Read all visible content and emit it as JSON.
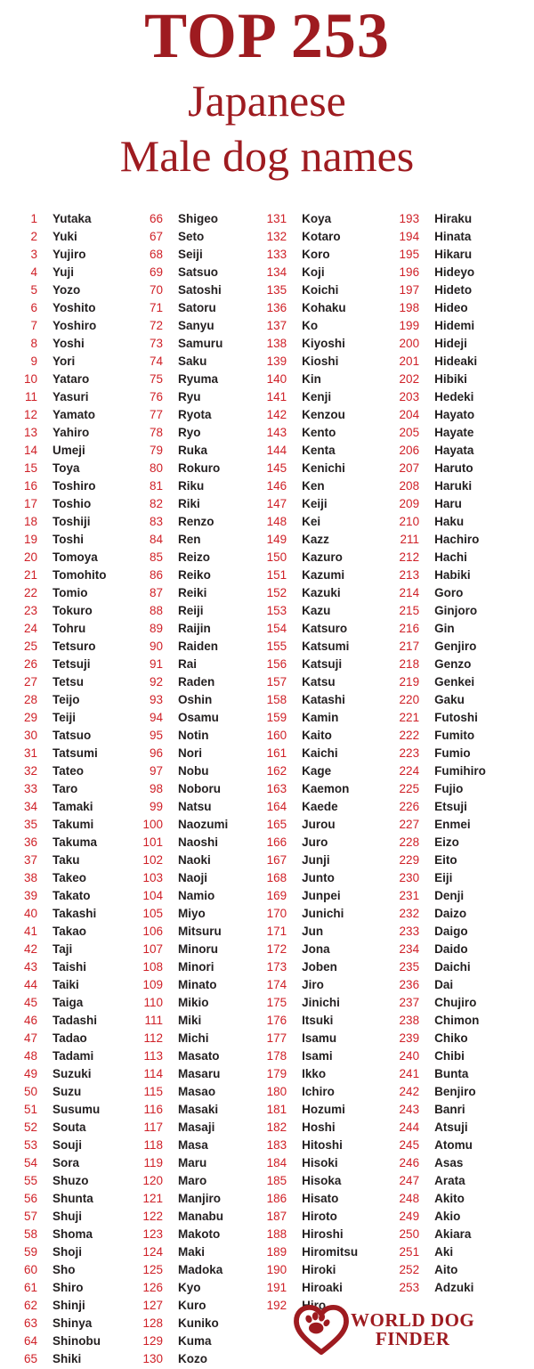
{
  "header": {
    "title_main": "TOP 253",
    "title_sub1": "Japanese",
    "title_sub2": "Male dog names"
  },
  "colors": {
    "title_red": "#9e1b20",
    "rank_red": "#cf2027",
    "name_dark": "#231f20",
    "background": "#ffffff"
  },
  "logo": {
    "mark_icon": "heart-paw-icon",
    "line1": "WORLD DOG",
    "line2": "FINDER"
  },
  "columns": [
    {
      "id": "column-1",
      "entries": [
        {
          "rank": "1",
          "name": "Yutaka"
        },
        {
          "rank": "2",
          "name": "Yuki"
        },
        {
          "rank": "3",
          "name": "Yujiro"
        },
        {
          "rank": "4",
          "name": "Yuji"
        },
        {
          "rank": "5",
          "name": "Yozo"
        },
        {
          "rank": "6",
          "name": "Yoshito"
        },
        {
          "rank": "7",
          "name": "Yoshiro"
        },
        {
          "rank": "8",
          "name": "Yoshi"
        },
        {
          "rank": "9",
          "name": "Yori"
        },
        {
          "rank": "10",
          "name": "Yataro"
        },
        {
          "rank": "11",
          "name": "Yasuri"
        },
        {
          "rank": "12",
          "name": "Yamato"
        },
        {
          "rank": "13",
          "name": "Yahiro"
        },
        {
          "rank": "14",
          "name": "Umeji"
        },
        {
          "rank": "15",
          "name": "Toya"
        },
        {
          "rank": "16",
          "name": "Toshiro"
        },
        {
          "rank": "17",
          "name": "Toshio"
        },
        {
          "rank": "18",
          "name": "Toshiji"
        },
        {
          "rank": "19",
          "name": "Toshi"
        },
        {
          "rank": "20",
          "name": "Tomoya"
        },
        {
          "rank": "21",
          "name": "Tomohito"
        },
        {
          "rank": "22",
          "name": "Tomio"
        },
        {
          "rank": "23",
          "name": "Tokuro"
        },
        {
          "rank": "24",
          "name": "Tohru"
        },
        {
          "rank": "25",
          "name": "Tetsuro"
        },
        {
          "rank": "26",
          "name": "Tetsuji"
        },
        {
          "rank": "27",
          "name": "Tetsu"
        },
        {
          "rank": "28",
          "name": "Teijo"
        },
        {
          "rank": "29",
          "name": "Teiji"
        },
        {
          "rank": "30",
          "name": "Tatsuo"
        },
        {
          "rank": "31",
          "name": "Tatsumi"
        },
        {
          "rank": "32",
          "name": "Tateo"
        },
        {
          "rank": "33",
          "name": "Taro"
        },
        {
          "rank": "34",
          "name": "Tamaki"
        },
        {
          "rank": "35",
          "name": "Takumi"
        },
        {
          "rank": "36",
          "name": "Takuma"
        },
        {
          "rank": "37",
          "name": "Taku"
        },
        {
          "rank": "38",
          "name": "Takeo"
        },
        {
          "rank": "39",
          "name": "Takato"
        },
        {
          "rank": "40",
          "name": "Takashi"
        },
        {
          "rank": "41",
          "name": "Takao"
        },
        {
          "rank": "42",
          "name": "Taji"
        },
        {
          "rank": "43",
          "name": "Taishi"
        },
        {
          "rank": "44",
          "name": "Taiki"
        },
        {
          "rank": "45",
          "name": "Taiga"
        },
        {
          "rank": "46",
          "name": "Tadashi"
        },
        {
          "rank": "47",
          "name": "Tadao"
        },
        {
          "rank": "48",
          "name": "Tadami"
        },
        {
          "rank": "49",
          "name": "Suzuki"
        },
        {
          "rank": "50",
          "name": "Suzu"
        },
        {
          "rank": "51",
          "name": "Susumu"
        },
        {
          "rank": "52",
          "name": "Souta"
        },
        {
          "rank": "53",
          "name": "Souji"
        },
        {
          "rank": "54",
          "name": "Sora"
        },
        {
          "rank": "55",
          "name": "Shuzo"
        },
        {
          "rank": "56",
          "name": "Shunta"
        },
        {
          "rank": "57",
          "name": "Shuji"
        },
        {
          "rank": "58",
          "name": "Shoma"
        },
        {
          "rank": "59",
          "name": "Shoji"
        },
        {
          "rank": "60",
          "name": "Sho"
        },
        {
          "rank": "61",
          "name": "Shiro"
        },
        {
          "rank": "62",
          "name": "Shinji"
        },
        {
          "rank": "63",
          "name": "Shinya"
        },
        {
          "rank": "64",
          "name": "Shinobu"
        },
        {
          "rank": "65",
          "name": "Shiki"
        }
      ]
    },
    {
      "id": "column-2",
      "entries": [
        {
          "rank": "66",
          "name": "Shigeo"
        },
        {
          "rank": "67",
          "name": "Seto"
        },
        {
          "rank": "68",
          "name": "Seiji"
        },
        {
          "rank": "69",
          "name": "Satsuo"
        },
        {
          "rank": "70",
          "name": "Satoshi"
        },
        {
          "rank": "71",
          "name": "Satoru"
        },
        {
          "rank": "72",
          "name": "Sanyu"
        },
        {
          "rank": "73",
          "name": "Samuru"
        },
        {
          "rank": "74",
          "name": "Saku"
        },
        {
          "rank": "75",
          "name": "Ryuma"
        },
        {
          "rank": "76",
          "name": "Ryu"
        },
        {
          "rank": "77",
          "name": "Ryota"
        },
        {
          "rank": "78",
          "name": "Ryo"
        },
        {
          "rank": "79",
          "name": "Ruka"
        },
        {
          "rank": "80",
          "name": "Rokuro"
        },
        {
          "rank": "81",
          "name": "Riku"
        },
        {
          "rank": "82",
          "name": "Riki"
        },
        {
          "rank": "83",
          "name": "Renzo"
        },
        {
          "rank": "84",
          "name": "Ren"
        },
        {
          "rank": "85",
          "name": "Reizo"
        },
        {
          "rank": "86",
          "name": "Reiko"
        },
        {
          "rank": "87",
          "name": "Reiki"
        },
        {
          "rank": "88",
          "name": "Reiji"
        },
        {
          "rank": "89",
          "name": "Raijin"
        },
        {
          "rank": "90",
          "name": "Raiden"
        },
        {
          "rank": "91",
          "name": "Rai"
        },
        {
          "rank": "92",
          "name": "Raden"
        },
        {
          "rank": "93",
          "name": "Oshin"
        },
        {
          "rank": "94",
          "name": "Osamu"
        },
        {
          "rank": "95",
          "name": "Notin"
        },
        {
          "rank": "96",
          "name": "Nori"
        },
        {
          "rank": "97",
          "name": "Nobu"
        },
        {
          "rank": "98",
          "name": "Noboru"
        },
        {
          "rank": "99",
          "name": "Natsu"
        },
        {
          "rank": "100",
          "name": "Naozumi"
        },
        {
          "rank": "101",
          "name": "Naoshi"
        },
        {
          "rank": "102",
          "name": "Naoki"
        },
        {
          "rank": "103",
          "name": "Naoji"
        },
        {
          "rank": "104",
          "name": "Namio"
        },
        {
          "rank": "105",
          "name": "Miyo"
        },
        {
          "rank": "106",
          "name": "Mitsuru"
        },
        {
          "rank": "107",
          "name": "Minoru"
        },
        {
          "rank": "108",
          "name": "Minori"
        },
        {
          "rank": "109",
          "name": "Minato"
        },
        {
          "rank": "110",
          "name": "Mikio"
        },
        {
          "rank": "111",
          "name": "Miki"
        },
        {
          "rank": "112",
          "name": "Michi"
        },
        {
          "rank": "113",
          "name": "Masato"
        },
        {
          "rank": "114",
          "name": "Masaru"
        },
        {
          "rank": "115",
          "name": "Masao"
        },
        {
          "rank": "116",
          "name": "Masaki"
        },
        {
          "rank": "117",
          "name": "Masaji"
        },
        {
          "rank": "118",
          "name": "Masa"
        },
        {
          "rank": "119",
          "name": "Maru"
        },
        {
          "rank": "120",
          "name": "Maro"
        },
        {
          "rank": "121",
          "name": "Manjiro"
        },
        {
          "rank": "122",
          "name": "Manabu"
        },
        {
          "rank": "123",
          "name": "Makoto"
        },
        {
          "rank": "124",
          "name": "Maki"
        },
        {
          "rank": "125",
          "name": "Madoka"
        },
        {
          "rank": "126",
          "name": "Kyo"
        },
        {
          "rank": "127",
          "name": "Kuro"
        },
        {
          "rank": "128",
          "name": "Kuniko"
        },
        {
          "rank": "129",
          "name": "Kuma"
        },
        {
          "rank": "130",
          "name": "Kozo"
        }
      ]
    },
    {
      "id": "column-3",
      "entries": [
        {
          "rank": "131",
          "name": "Koya"
        },
        {
          "rank": "132",
          "name": "Kotaro"
        },
        {
          "rank": "133",
          "name": "Koro"
        },
        {
          "rank": "134",
          "name": "Koji"
        },
        {
          "rank": "135",
          "name": "Koichi"
        },
        {
          "rank": "136",
          "name": "Kohaku"
        },
        {
          "rank": "137",
          "name": "Ko"
        },
        {
          "rank": "138",
          "name": "Kiyoshi"
        },
        {
          "rank": "139",
          "name": "Kioshi"
        },
        {
          "rank": "140",
          "name": "Kin"
        },
        {
          "rank": "141",
          "name": "Kenji"
        },
        {
          "rank": "142",
          "name": "Kenzou"
        },
        {
          "rank": "143",
          "name": "Kento"
        },
        {
          "rank": "144",
          "name": "Kenta"
        },
        {
          "rank": "145",
          "name": "Kenichi"
        },
        {
          "rank": "146",
          "name": "Ken"
        },
        {
          "rank": "147",
          "name": "Keiji"
        },
        {
          "rank": "148",
          "name": "Kei"
        },
        {
          "rank": "149",
          "name": "Kazz"
        },
        {
          "rank": "150",
          "name": "Kazuro"
        },
        {
          "rank": "151",
          "name": "Kazumi"
        },
        {
          "rank": "152",
          "name": "Kazuki"
        },
        {
          "rank": "153",
          "name": "Kazu"
        },
        {
          "rank": "154",
          "name": "Katsuro"
        },
        {
          "rank": "155",
          "name": "Katsumi"
        },
        {
          "rank": "156",
          "name": "Katsuji"
        },
        {
          "rank": "157",
          "name": "Katsu"
        },
        {
          "rank": "158",
          "name": "Katashi"
        },
        {
          "rank": "159",
          "name": "Kamin"
        },
        {
          "rank": "160",
          "name": "Kaito"
        },
        {
          "rank": "161",
          "name": "Kaichi"
        },
        {
          "rank": "162",
          "name": "Kage"
        },
        {
          "rank": "163",
          "name": "Kaemon"
        },
        {
          "rank": "164",
          "name": "Kaede"
        },
        {
          "rank": "165",
          "name": "Jurou"
        },
        {
          "rank": "166",
          "name": "Juro"
        },
        {
          "rank": "167",
          "name": "Junji"
        },
        {
          "rank": "168",
          "name": "Junto"
        },
        {
          "rank": "169",
          "name": "Junpei"
        },
        {
          "rank": "170",
          "name": "Junichi"
        },
        {
          "rank": "171",
          "name": "Jun"
        },
        {
          "rank": "172",
          "name": "Jona"
        },
        {
          "rank": "173",
          "name": "Joben"
        },
        {
          "rank": "174",
          "name": "Jiro"
        },
        {
          "rank": "175",
          "name": "Jinichi"
        },
        {
          "rank": "176",
          "name": "Itsuki"
        },
        {
          "rank": "177",
          "name": "Isamu"
        },
        {
          "rank": "178",
          "name": "Isami"
        },
        {
          "rank": "179",
          "name": "Ikko"
        },
        {
          "rank": "180",
          "name": "Ichiro"
        },
        {
          "rank": "181",
          "name": "Hozumi"
        },
        {
          "rank": "182",
          "name": "Hoshi"
        },
        {
          "rank": "183",
          "name": "Hitoshi"
        },
        {
          "rank": "184",
          "name": "Hisoki"
        },
        {
          "rank": "185",
          "name": "Hisoka"
        },
        {
          "rank": "186",
          "name": "Hisato"
        },
        {
          "rank": "187",
          "name": "Hiroto"
        },
        {
          "rank": "188",
          "name": "Hiroshi"
        },
        {
          "rank": "189",
          "name": "Hiromitsu"
        },
        {
          "rank": "190",
          "name": "Hiroki"
        },
        {
          "rank": "191",
          "name": "Hiroaki"
        },
        {
          "rank": "192",
          "name": "Hiro"
        }
      ]
    },
    {
      "id": "column-4",
      "entries": [
        {
          "rank": "193",
          "name": "Hiraku"
        },
        {
          "rank": "194",
          "name": "Hinata"
        },
        {
          "rank": "195",
          "name": "Hikaru"
        },
        {
          "rank": "196",
          "name": "Hideyo"
        },
        {
          "rank": "197",
          "name": "Hideto"
        },
        {
          "rank": "198",
          "name": "Hideo"
        },
        {
          "rank": "199",
          "name": "Hidemi"
        },
        {
          "rank": "200",
          "name": "Hideji"
        },
        {
          "rank": "201",
          "name": "Hideaki"
        },
        {
          "rank": "202",
          "name": "Hibiki"
        },
        {
          "rank": "203",
          "name": "Hedeki"
        },
        {
          "rank": "204",
          "name": "Hayato"
        },
        {
          "rank": "205",
          "name": "Hayate"
        },
        {
          "rank": "206",
          "name": "Hayata"
        },
        {
          "rank": "207",
          "name": "Haruto"
        },
        {
          "rank": "208",
          "name": "Haruki"
        },
        {
          "rank": "209",
          "name": "Haru"
        },
        {
          "rank": "210",
          "name": "Haku"
        },
        {
          "rank": "211",
          "name": "Hachiro"
        },
        {
          "rank": "212",
          "name": "Hachi"
        },
        {
          "rank": "213",
          "name": "Habiki"
        },
        {
          "rank": "214",
          "name": "Goro"
        },
        {
          "rank": "215",
          "name": "Ginjoro"
        },
        {
          "rank": "216",
          "name": "Gin"
        },
        {
          "rank": "217",
          "name": "Genjiro"
        },
        {
          "rank": "218",
          "name": "Genzo"
        },
        {
          "rank": "219",
          "name": "Genkei"
        },
        {
          "rank": "220",
          "name": "Gaku"
        },
        {
          "rank": "221",
          "name": "Futoshi"
        },
        {
          "rank": "222",
          "name": "Fumito"
        },
        {
          "rank": "223",
          "name": "Fumio"
        },
        {
          "rank": "224",
          "name": "Fumihiro"
        },
        {
          "rank": "225",
          "name": "Fujio"
        },
        {
          "rank": "226",
          "name": "Etsuji"
        },
        {
          "rank": "227",
          "name": "Enmei"
        },
        {
          "rank": "228",
          "name": "Eizo"
        },
        {
          "rank": "229",
          "name": "Eito"
        },
        {
          "rank": "230",
          "name": "Eiji"
        },
        {
          "rank": "231",
          "name": "Denji"
        },
        {
          "rank": "232",
          "name": "Daizo"
        },
        {
          "rank": "233",
          "name": "Daigo"
        },
        {
          "rank": "234",
          "name": "Daido"
        },
        {
          "rank": "235",
          "name": "Daichi"
        },
        {
          "rank": "236",
          "name": "Dai"
        },
        {
          "rank": "237",
          "name": "Chujiro"
        },
        {
          "rank": "238",
          "name": "Chimon"
        },
        {
          "rank": "239",
          "name": "Chiko"
        },
        {
          "rank": "240",
          "name": "Chibi"
        },
        {
          "rank": "241",
          "name": "Bunta"
        },
        {
          "rank": "242",
          "name": "Benjiro"
        },
        {
          "rank": "243",
          "name": "Banri"
        },
        {
          "rank": "244",
          "name": "Atsuji"
        },
        {
          "rank": "245",
          "name": "Atomu"
        },
        {
          "rank": "246",
          "name": "Asas"
        },
        {
          "rank": "247",
          "name": "Arata"
        },
        {
          "rank": "248",
          "name": "Akito"
        },
        {
          "rank": "249",
          "name": "Akio"
        },
        {
          "rank": "250",
          "name": "Akiara"
        },
        {
          "rank": "251",
          "name": "Aki"
        },
        {
          "rank": "252",
          "name": "Aito"
        },
        {
          "rank": "253",
          "name": "Adzuki"
        }
      ]
    }
  ]
}
